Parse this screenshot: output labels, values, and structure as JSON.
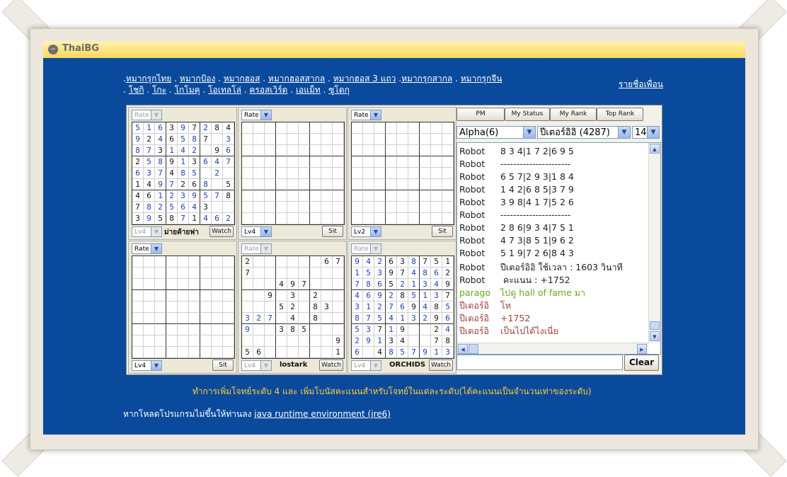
{
  "app": {
    "brand": "ThaiBG"
  },
  "nav": {
    "row1": [
      "หมากรุกไทย",
      "หมากป้อง",
      "หมากฮอส",
      "หมากฮอสสากล",
      "หมากฮอส 3 แถว",
      "หมากรุกสากล",
      "หมากรุกจีน"
    ],
    "row2": [
      "โชกิ",
      "โกะ",
      "โกโมคุ",
      "โอเทลโล่",
      "ครอสเวิร์ด",
      "เอแม็ท",
      "ซูโดกุ"
    ],
    "friends": "รายชื่อเพื่อน"
  },
  "boards": [
    {
      "rate": "Rate",
      "rate_disabled": true,
      "level": "Lv4",
      "level_disabled": true,
      "player": "ม่ายค้ายฟา",
      "button": "Watch",
      "cells": [
        [
          "5",
          "1",
          "6",
          "3",
          "9",
          "7",
          "2",
          "8",
          "4"
        ],
        [
          "9",
          "2",
          "4",
          "6",
          "5",
          "8",
          "7",
          "",
          "3"
        ],
        [
          "8",
          "7",
          "3",
          "1",
          "4",
          "2",
          "",
          "9",
          "6"
        ],
        [
          "2",
          "5",
          "8",
          "9",
          "1",
          "3",
          "6",
          "4",
          "7"
        ],
        [
          "6",
          "3",
          "7",
          "4",
          "8",
          "5",
          "",
          "2",
          ""
        ],
        [
          "1",
          "4",
          "9",
          "7",
          "2",
          "6",
          "8",
          "",
          "5"
        ],
        [
          "4",
          "6",
          "1",
          "2",
          "3",
          "9",
          "5",
          "7",
          "8"
        ],
        [
          "7",
          "8",
          "2",
          "5",
          "6",
          "4",
          "3",
          "",
          ""
        ],
        [
          "3",
          "9",
          "5",
          "8",
          "7",
          "1",
          "4",
          "6",
          "2"
        ]
      ]
    },
    {
      "rate": "Rate",
      "rate_disabled": false,
      "level": "Lv4",
      "level_disabled": false,
      "player": "",
      "button": "Sit",
      "cells": []
    },
    {
      "rate": "Rate",
      "rate_disabled": false,
      "level": "Lv2",
      "level_disabled": false,
      "player": "",
      "button": "Sit",
      "cells": []
    },
    {
      "rate": "Rate",
      "rate_disabled": false,
      "level": "Lv4",
      "level_disabled": false,
      "player": "",
      "button": "Sit",
      "cells": []
    },
    {
      "rate": "Rate",
      "rate_disabled": true,
      "level": "Lv4",
      "level_disabled": true,
      "player": "lostark",
      "button": "Watch",
      "cells": [
        [
          "2",
          "",
          "",
          "",
          "",
          "",
          "",
          "6",
          "7"
        ],
        [
          "7",
          "",
          "",
          "",
          "",
          "",
          "",
          "",
          ""
        ],
        [
          "",
          "",
          "",
          "4",
          "9",
          "7",
          "",
          "",
          ""
        ],
        [
          "",
          "",
          "9",
          "",
          "3",
          "",
          "2",
          "",
          ""
        ],
        [
          "",
          "",
          "",
          "5",
          "2",
          "",
          "8",
          "3",
          ""
        ],
        [
          "3",
          "2",
          "7",
          "",
          "4",
          "",
          "8",
          "",
          ""
        ],
        [
          "9",
          "",
          "",
          "3",
          "8",
          "5",
          "",
          "",
          ""
        ],
        [
          "",
          "",
          "",
          "",
          "",
          "",
          "",
          "",
          "9"
        ],
        [
          "5",
          "6",
          "",
          "",
          "",
          "",
          "",
          "",
          "1"
        ]
      ]
    },
    {
      "rate": "Rate",
      "rate_disabled": true,
      "level": "Lv4",
      "level_disabled": true,
      "player": "ORCHIDS",
      "button": "Watch",
      "cells": [
        [
          "9",
          "4",
          "2",
          "6",
          "3",
          "8",
          "7",
          "5",
          "1"
        ],
        [
          "1",
          "5",
          "3",
          "9",
          "7",
          "4",
          "8",
          "6",
          "2"
        ],
        [
          "7",
          "8",
          "6",
          "5",
          "2",
          "1",
          "3",
          "4",
          "9"
        ],
        [
          "4",
          "6",
          "9",
          "2",
          "8",
          "5",
          "1",
          "3",
          "7"
        ],
        [
          "3",
          "1",
          "2",
          "7",
          "6",
          "9",
          "4",
          "8",
          "5"
        ],
        [
          "8",
          "7",
          "5",
          "4",
          "1",
          "3",
          "2",
          "9",
          "6"
        ],
        [
          "5",
          "3",
          "7",
          "1",
          "9",
          "",
          "",
          "2",
          "4"
        ],
        [
          "2",
          "9",
          "1",
          "3",
          "4",
          "",
          "",
          "7",
          "8"
        ],
        [
          "6",
          "",
          "4",
          "8",
          "5",
          "7",
          "9",
          "1",
          "3"
        ]
      ]
    }
  ],
  "chat": {
    "buttons": [
      "PM",
      "My Status",
      "My Rank",
      "Top Rank"
    ],
    "room": "Alpha(6)",
    "user": "ปีเตอร์อิอิ (4287)",
    "size": "14",
    "messages": [
      {
        "who": "Robot",
        "text": "8 3 4|1 7 2|6 9 5",
        "color": "#222222"
      },
      {
        "who": "Robot",
        "text": "----------------------",
        "color": "#222222"
      },
      {
        "who": "Robot",
        "text": "6 5 7|2 9 3|1 8 4",
        "color": "#222222"
      },
      {
        "who": "Robot",
        "text": "1 4 2|6 8 5|3 7 9",
        "color": "#222222"
      },
      {
        "who": "Robot",
        "text": "3 9 8|4 1 7|5 2 6",
        "color": "#222222"
      },
      {
        "who": "Robot",
        "text": "----------------------",
        "color": "#222222"
      },
      {
        "who": "Robot",
        "text": "2 8 6|9 3 4|7 5 1",
        "color": "#222222"
      },
      {
        "who": "Robot",
        "text": "4 7 3|8 5 1|9 6 2",
        "color": "#222222"
      },
      {
        "who": "Robot",
        "text": "5 1 9|7 2 6|8 4 3",
        "color": "#222222"
      },
      {
        "who": "Robot",
        "text": "ปีเตอร์อิอิ ใช้เวลา : 1603 วินาที",
        "color": "#222222"
      },
      {
        "who": "Robot",
        "text": " คะแนน : +1752",
        "color": "#222222"
      },
      {
        "who": "parago",
        "text": "ไปดู hall of fame มา",
        "color": "#66aa22"
      },
      {
        "who": "ปีเตอร์อิ",
        "text": "โห",
        "color": "#a04040"
      },
      {
        "who": "ปีเตอร์อิ",
        "text": "+1752",
        "color": "#a04040"
      },
      {
        "who": "ปีเตอร์อิ",
        "text": "เป็นไปได้ไงเนี่ย",
        "color": "#a04040"
      }
    ],
    "input_value": "",
    "clear_label": "Clear"
  },
  "notice": "ทำการเพิ่มโจทย์ระดับ 4 และ เพิ่มโบนัสคะแนนสำหรับโจทย์ในแต่ละระดับ(ได้คะแนนเป็นจำนวนเท่าของระดับ)",
  "download": {
    "prefix": "หากโหลดโปรแกรมไม่ขึ้นให้ท่านลง ",
    "link": "java runtime environment (jre6)"
  },
  "colors": {
    "background": "#0a4a9c",
    "titlebar": "#ffd75a",
    "notice": "#ffcc33",
    "digit_blue": "#1a3fb5"
  }
}
